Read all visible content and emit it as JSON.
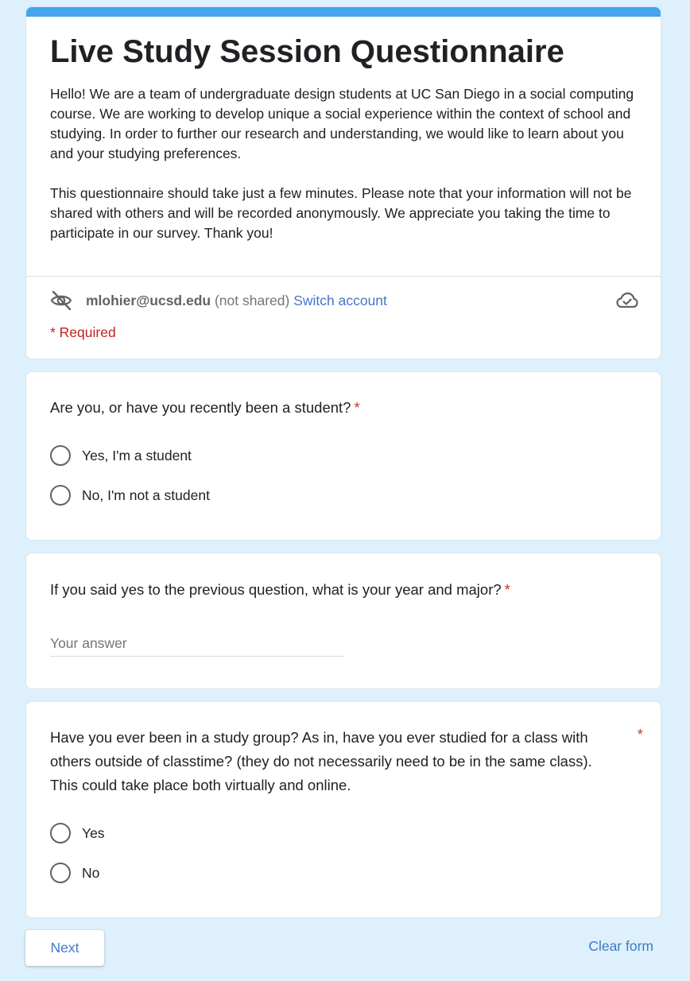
{
  "form": {
    "title": "Live Study Session Questionnaire",
    "description_p1": "Hello! We are a team of undergraduate design students at UC San Diego in a social computing course. We are working to develop unique a social experience within the context of school and studying. In order to further our research and understanding, we would like to learn about you and your studying preferences.",
    "description_p2": "This questionnaire should take just a few minutes. Please note that your information will not be shared with others and will be recorded anonymously. We appreciate you taking the time to participate in our survey. Thank you!",
    "accent_color": "#42a5f0",
    "background_color": "#ddf0fb"
  },
  "account": {
    "email": "mlohier@ucsd.edu",
    "not_shared": "(not shared)",
    "switch_label": "Switch account",
    "hidden_icon": "eye-off-icon",
    "cloud_icon": "cloud-check-icon"
  },
  "required_note": "* Required",
  "questions": [
    {
      "text": "Are you, or have you recently been a student?",
      "required": "*",
      "options": [
        "Yes, I'm a student",
        "No, I'm not a student"
      ]
    },
    {
      "text": "If you said yes to the previous question, what is your year and major?",
      "required": "*",
      "placeholder": "Your answer"
    },
    {
      "text": "Have you ever been in a study group? As in, have you ever studied for a class with others outside of classtime? (they do not necessarily need to be in the same class). This could take place both virtually and online.",
      "required": "*",
      "options": [
        "Yes",
        "No"
      ]
    }
  ],
  "footer": {
    "next_label": "Next",
    "clear_label": "Clear form"
  }
}
